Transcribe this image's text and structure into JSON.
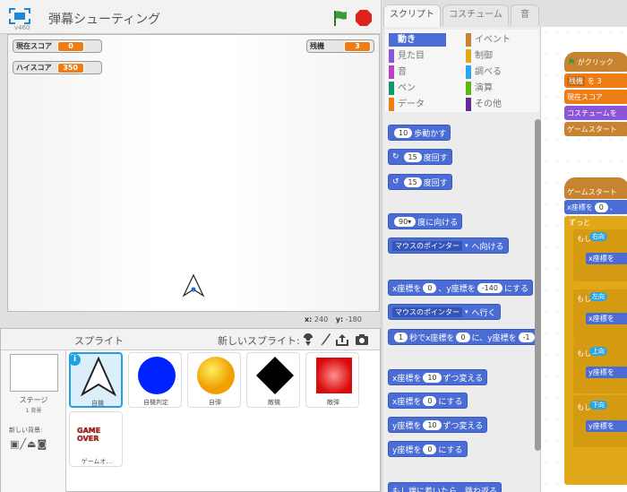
{
  "project": {
    "version": "v460",
    "title": "弾幕シューティング"
  },
  "monitors": {
    "score": {
      "label": "現在スコア",
      "value": "0"
    },
    "high": {
      "label": "ハイスコア",
      "value": "350"
    },
    "lives": {
      "label": "残機",
      "value": "3"
    }
  },
  "mouse": {
    "x_label": "x:",
    "x": "240",
    "y_label": "y:",
    "y": "-180"
  },
  "sprites_panel": {
    "title": "スプライト",
    "new_sprite": "新しいスプライト:",
    "stage_label": "ステージ",
    "stage_count": "1 背景",
    "new_bg": "新しい背景:"
  },
  "sprites": [
    {
      "name": "自機"
    },
    {
      "name": "自機判定"
    },
    {
      "name": "自弾"
    },
    {
      "name": "敵機"
    },
    {
      "name": "敵弾"
    },
    {
      "name": "ゲームオ…",
      "thumb_text": "GAME OVER"
    }
  ],
  "tabs": [
    {
      "label": "スクリプト"
    },
    {
      "label": "コスチューム"
    },
    {
      "label": "音"
    }
  ],
  "categories": [
    {
      "label": "動き",
      "color": "#4a6cd4"
    },
    {
      "label": "イベント",
      "color": "#c88330"
    },
    {
      "label": "見た目",
      "color": "#8a55d7"
    },
    {
      "label": "制御",
      "color": "#e1a91a"
    },
    {
      "label": "音",
      "color": "#bb42c3"
    },
    {
      "label": "調べる",
      "color": "#2ca5e2"
    },
    {
      "label": "ペン",
      "color": "#0e9a6c"
    },
    {
      "label": "演算",
      "color": "#5cb712"
    },
    {
      "label": "データ",
      "color": "#ee7d16"
    },
    {
      "label": "その他",
      "color": "#632d99"
    }
  ],
  "blocks": {
    "move": {
      "n": "10",
      "t": "歩動かす"
    },
    "turn_r": {
      "n": "15",
      "t": "度回す"
    },
    "turn_l": {
      "n": "15",
      "t": "度回す"
    },
    "point_dir": {
      "n": "90▾",
      "t": "度に向ける"
    },
    "point_toward": {
      "dd": "マウスのポインター",
      "t": "へ向ける"
    },
    "goto_xy": {
      "a": "x座標を",
      "x": "0",
      "b": "、y座標を",
      "y": "-140",
      "c": "にする"
    },
    "goto": {
      "dd": "マウスのポインター",
      "t": "へ行く"
    },
    "glide": {
      "n": "1",
      "a": "秒でx座標を",
      "x": "0",
      "b": "に、y座標を",
      "y": "-1"
    },
    "change_x": {
      "a": "x座標を",
      "n": "10",
      "b": "ずつ変える"
    },
    "set_x": {
      "a": "x座標を",
      "n": "0",
      "b": "にする"
    },
    "change_y": {
      "a": "y座標を",
      "n": "10",
      "b": "ずつ変える"
    },
    "set_y": {
      "a": "y座標を",
      "n": "0",
      "b": "にする"
    },
    "bounce": {
      "t": "もし端に着いたら、跳ね返る"
    }
  },
  "scripts": {
    "hat1": "がクリック",
    "s1": "残機",
    "s1v": "を 3",
    "s2": "現在スコア",
    "s3": "コスチュームを",
    "s4": "ゲームスタート",
    "hat2": "ゲームスタート",
    "s5": "x座標を",
    "s5v": "0",
    "s5t": "、",
    "forever": "ずっと",
    "if1": "もし",
    "k1": "右向",
    "m1": "x座標を",
    "if2": "もし",
    "k2": "左向",
    "m2": "x座標を",
    "if3": "もし",
    "k3": "上向",
    "m3": "y座標を",
    "if4": "もし",
    "k4": "下向",
    "m4": "y座標を"
  }
}
